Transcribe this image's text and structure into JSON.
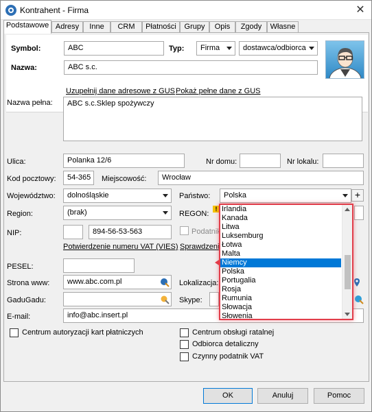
{
  "window": {
    "title": "Kontrahent - Firma"
  },
  "tabs": [
    "Podstawowe",
    "Adresy",
    "Inne",
    "CRM",
    "Płatności",
    "Grupy",
    "Opis",
    "Zgody",
    "Własne"
  ],
  "header": {
    "symbol_label": "Symbol:",
    "symbol_value": "ABC",
    "type_label": "Typ:",
    "type_value": "Firma",
    "role_value": "dostawca/odbiorca",
    "name_label": "Nazwa:",
    "name_value": "ABC s.c."
  },
  "links": {
    "gus_fill": "Uzupełnij dane adresowe z GUS",
    "gus_show": "Pokaż pełne dane z GUS",
    "vat_confirm": "Potwierdzenie numeru VAT (VIES)",
    "check": "Sprawdzenie"
  },
  "form": {
    "full_name_label": "Nazwa pełna:",
    "full_name_value": "ABC s.c.Sklep spożywczy",
    "street_label": "Ulica:",
    "street_value": "Polanka  12/6",
    "house_label": "Nr domu:",
    "house_value": "",
    "apt_label": "Nr lokalu:",
    "apt_value": "",
    "postal_label": "Kod pocztowy:",
    "postal_value": "54-365",
    "city_label": "Miejscowość:",
    "city_value": "Wrocław",
    "voiv_label": "Województwo:",
    "voiv_value": "dolnośląskie",
    "country_label": "Państwo:",
    "country_value": "Polska",
    "region_label": "Region:",
    "region_value": "(brak)",
    "regon_label": "REGON:",
    "nip_label": "NIP:",
    "nip_prefix": "",
    "nip_value": "894-56-53-563",
    "taxpayer_label": "Podatnik",
    "pesel_label": "PESEL:",
    "pesel_value": "",
    "www_label": "Strona www:",
    "www_value": "www.abc.com.pl",
    "location_label": "Lokalizacja:",
    "gadugadu_label": "GaduGadu:",
    "gadugadu_value": "",
    "skype_label": "Skype:",
    "email_label": "E-mail:",
    "email_value": "info@abc.insert.pl"
  },
  "checkboxes": {
    "card_center": "Centrum autoryzacji kart płatniczych",
    "installment_center": "Centrum obsługi ratalnej",
    "retail_receiver": "Odbiorca detaliczny",
    "active_vat": "Czynny podatnik VAT"
  },
  "dropdown": {
    "items": [
      "Irlandia",
      "Kanada",
      "Litwa",
      "Luksemburg",
      "Łotwa",
      "Malta",
      "Niemcy",
      "Polska",
      "Portugalia",
      "Rosja",
      "Rumunia",
      "Słowacja",
      "Słowenia"
    ],
    "selected_index": 6
  },
  "buttons": {
    "ok": "OK",
    "cancel": "Anuluj",
    "help": "Pomoc",
    "add": "+"
  },
  "colors": {
    "accent": "#0078d7",
    "highlight_border": "#e23d4a"
  }
}
